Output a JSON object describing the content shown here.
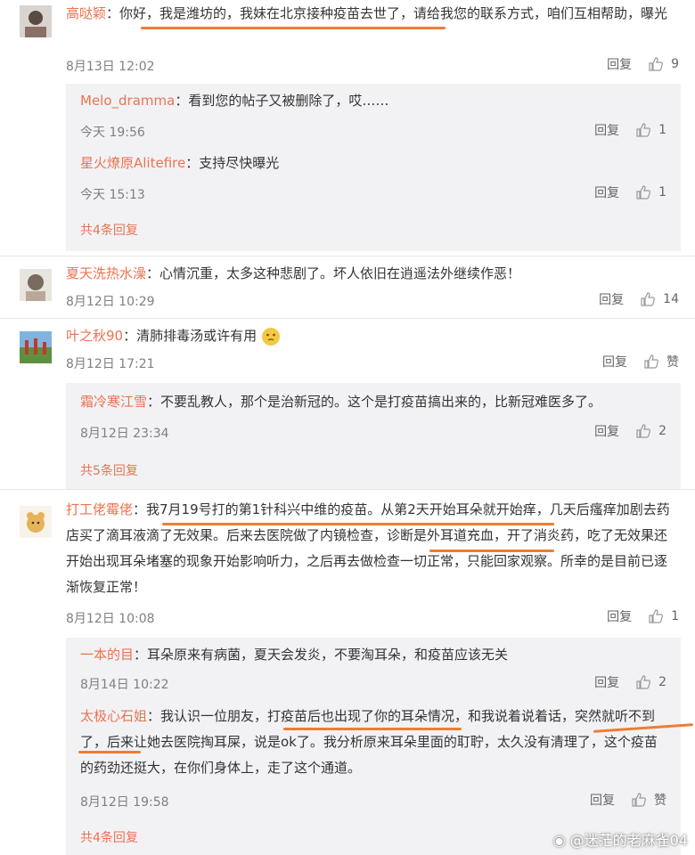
{
  "c1": {
    "name": "高哒颖",
    "text": "：你好，我是潍坊的，我妹在北京接种疫苗去世了，请给我您的联系方式，咱们互相帮助，曝光",
    "date": "8月13日 12:02",
    "reply": "回复",
    "likes": "9",
    "subs": [
      {
        "name": "Melo_dramma",
        "text": "：看到您的帖子又被删除了，哎……",
        "date": "今天 19:56",
        "reply": "回复",
        "likes": "1"
      },
      {
        "name": "星火燎原Alitefire",
        "text": "：支持尽快曝光",
        "date": "今天 15:13",
        "reply": "回复",
        "likes": "1"
      }
    ],
    "more": "共4条回复"
  },
  "c2": {
    "name": "夏天洗热水澡",
    "text": "：心情沉重，太多这种悲剧了。坏人依旧在逍遥法外继续作恶！",
    "date": "8月12日 10:29",
    "reply": "回复",
    "likes": "14"
  },
  "c3": {
    "name": "叶之秋90",
    "text": "：清肺排毒汤或许有用",
    "date": "8月12日 17:21",
    "reply": "回复",
    "likes": "赞",
    "subs": [
      {
        "name": "霜冷寒江雪",
        "text": "：不要乱教人，那个是治新冠的。这个是打疫苗搞出来的，比新冠难医多了。",
        "date": "8月12日 23:34",
        "reply": "回复",
        "likes": "2"
      }
    ],
    "more": "共5条回复"
  },
  "c4": {
    "name": "打工佬霉佬",
    "text": "：我7月19号打的第1针科兴中维的疫苗。从第2天开始耳朵就开始痒，几天后瘙痒加剧去药店买了滴耳液滴了无效果。后来去医院做了内镜检查，诊断是外耳道充血，开了消炎药，吃了无效果还开始出现耳朵堵塞的现象开始影响听力，之后再去做检查一切正常，只能回家观察。所幸的是目前已逐渐恢复正常！",
    "date": "8月12日 10:08",
    "reply": "回复",
    "likes": "1",
    "subs": [
      {
        "name": "一本的目",
        "text": "：耳朵原来有病菌，夏天会发炎，不要淘耳朵，和疫苗应该无关",
        "date": "8月14日 10:22",
        "reply": "回复",
        "likes": "2"
      },
      {
        "name": "太极心石姐",
        "text": "：我认识一位朋友，打疫苗后也出现了你的耳朵情况，和我说着说着话，突然就听不到了，后来让她去医院掏耳屎，说是ok了。我分析原来耳朵里面的耵聍，太久没有清理了，这个疫苗的药劲还挺大，在你们身体上，走了这个通道。",
        "date": "8月12日 19:58",
        "reply": "回复",
        "likes": "赞"
      }
    ],
    "more": "共4条回复"
  },
  "watermark": "@迷茫的老麻雀04",
  "colors": {
    "username": "#eb7350",
    "highlight": "#ef7d33",
    "reply_box": "#f2f2f5"
  }
}
